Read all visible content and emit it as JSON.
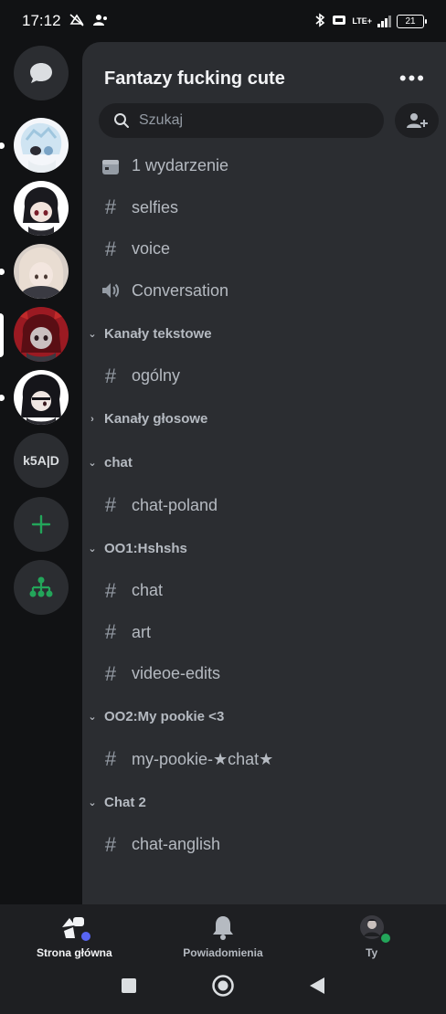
{
  "status_bar": {
    "time": "17:12",
    "battery": "21",
    "network": "LTE+"
  },
  "rail": {
    "servers": [
      {
        "name": "direct-messages"
      },
      {
        "name": "server-1",
        "indicator": "dot"
      },
      {
        "name": "server-2"
      },
      {
        "name": "server-3",
        "indicator": "dot"
      },
      {
        "name": "server-4",
        "indicator": "bar"
      },
      {
        "name": "server-5",
        "indicator": "dot"
      },
      {
        "name": "k5A|D",
        "label": "k5A|D"
      }
    ],
    "add_label": "+"
  },
  "header": {
    "server_name": "Fantazy fucking cute"
  },
  "search": {
    "placeholder": "Szukaj"
  },
  "channels": {
    "top": [
      {
        "icon": "calendar-icon",
        "label": "1 wydarzenie"
      },
      {
        "icon": "hash-icon",
        "label": "selfies"
      },
      {
        "icon": "hash-icon",
        "label": "voice"
      },
      {
        "icon": "speaker-icon",
        "label": "Conversation"
      }
    ],
    "categories": [
      {
        "label": "Kanały tekstowe",
        "expanded": true,
        "items": [
          "ogólny"
        ]
      },
      {
        "label": "Kanały głosowe",
        "expanded": false,
        "items": []
      },
      {
        "label": "chat",
        "expanded": true,
        "items": [
          "chat-poland"
        ]
      },
      {
        "label": "OO1:Hshshs",
        "expanded": true,
        "items": [
          "chat",
          "art",
          "videoe-edits"
        ]
      },
      {
        "label": "OO2:My pookie <3",
        "expanded": true,
        "items": [
          "my-pookie-★chat★"
        ]
      },
      {
        "label": "Chat 2",
        "expanded": true,
        "items": [
          "chat-anglish"
        ]
      }
    ]
  },
  "bottom_nav": {
    "home": "Strona główna",
    "notifications": "Powiadomienia",
    "you": "Ty"
  },
  "colors": {
    "accent": "#5865f2",
    "online": "#23a55a",
    "add_green": "#23a55a"
  }
}
